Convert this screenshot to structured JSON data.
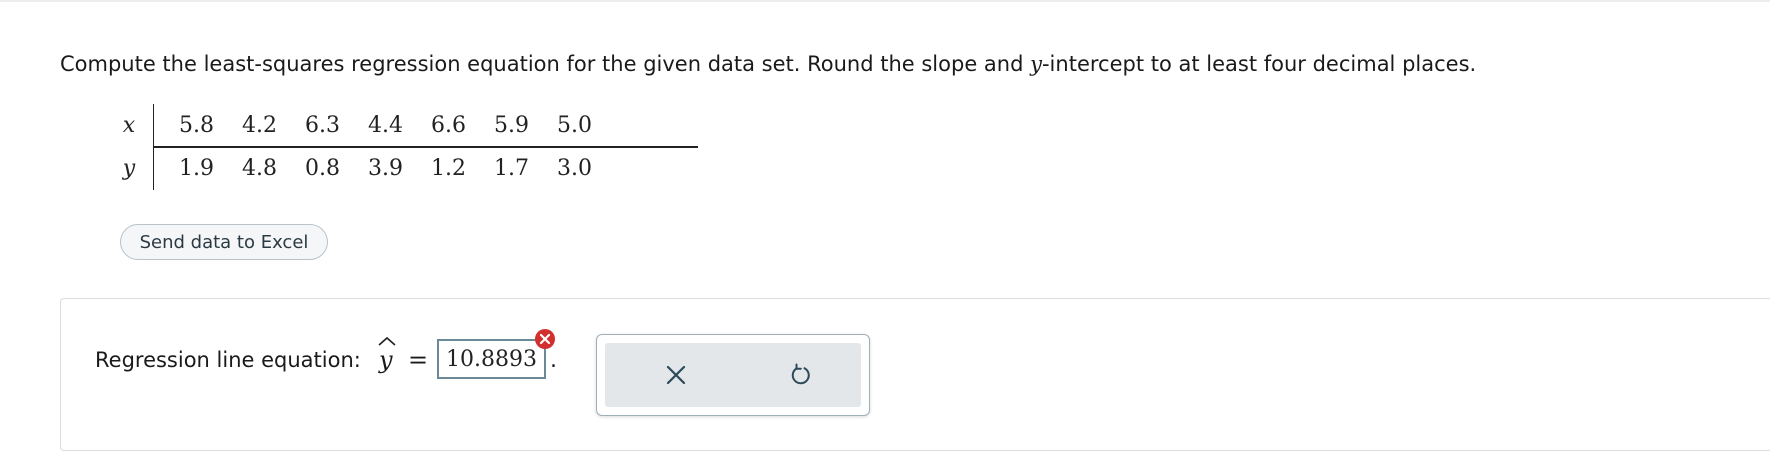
{
  "question": {
    "prompt_before_var": "Compute the least-squares regression equation for the given data set. Round the slope and ",
    "prompt_var": "y",
    "prompt_after_var": "-intercept to at least four decimal places."
  },
  "data_table": {
    "x_label": "x",
    "y_label": "y",
    "x_values": [
      "5.8",
      "4.2",
      "6.3",
      "4.4",
      "6.6",
      "5.9",
      "5.0"
    ],
    "y_values": [
      "1.9",
      "4.8",
      "0.8",
      "3.9",
      "1.2",
      "1.7",
      "3.0"
    ]
  },
  "excel_button": {
    "label": "Send data to Excel"
  },
  "answer": {
    "label": "Regression line equation:",
    "lhs_var": "y",
    "equals": "=",
    "input_value": "10.8893",
    "trailing": ".",
    "status": "incorrect",
    "error_color": "#d32f2f"
  },
  "actions": {
    "clear_icon": "close-icon",
    "undo_icon": "undo-icon"
  }
}
